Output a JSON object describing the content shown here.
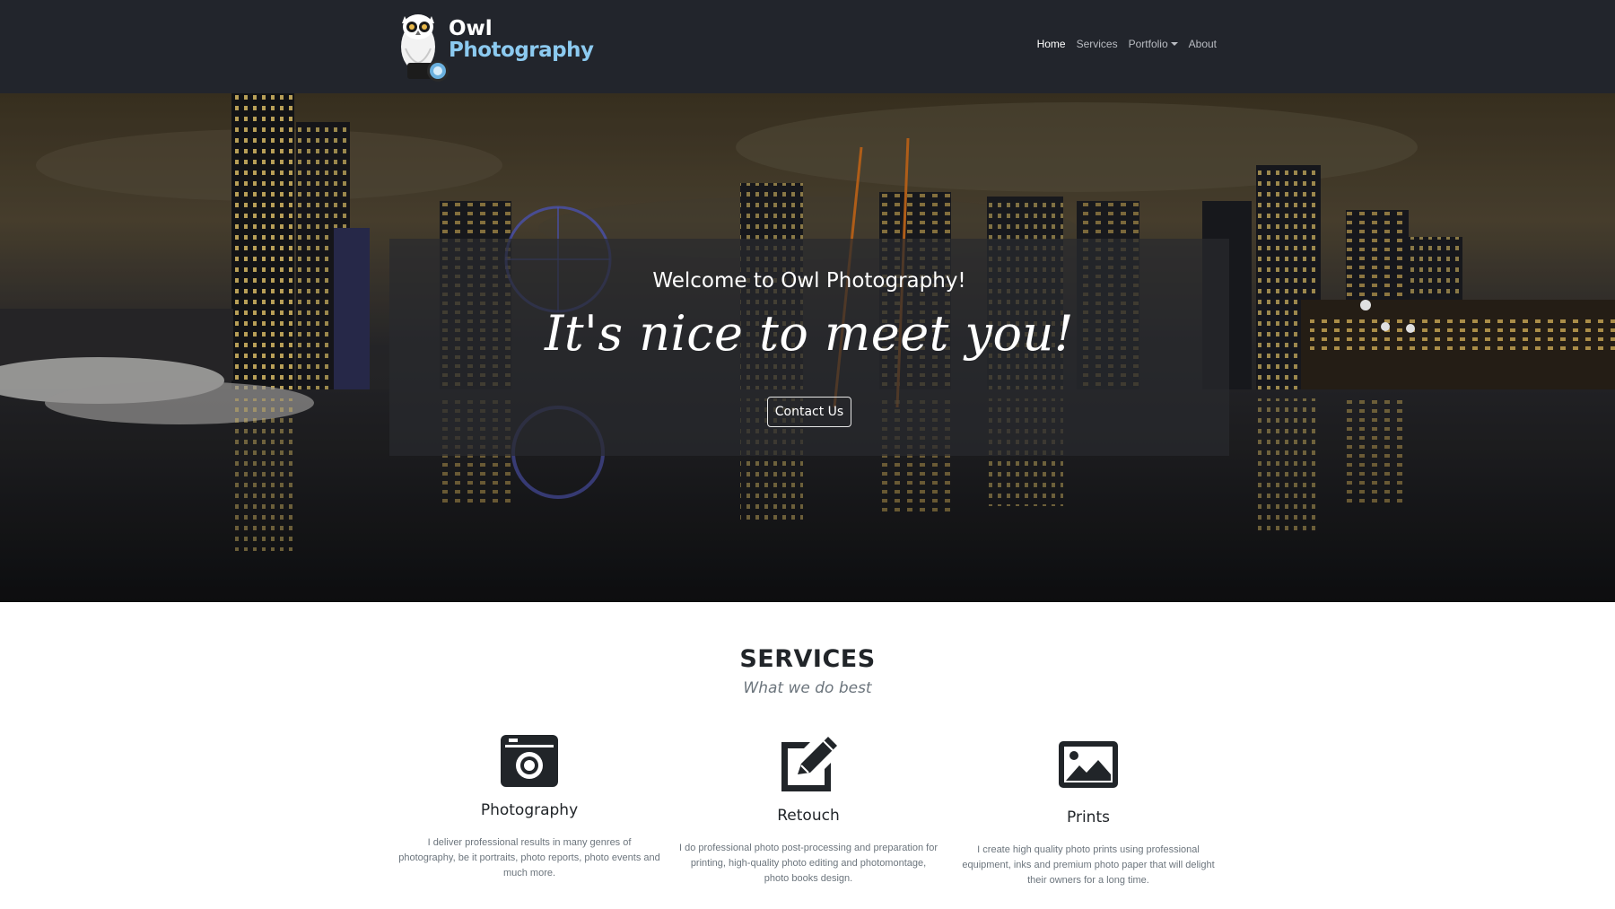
{
  "brand": {
    "line1": "Owl",
    "line2": "Photography"
  },
  "nav": {
    "items": [
      {
        "label": "Home",
        "active": true
      },
      {
        "label": "Services",
        "active": false
      },
      {
        "label": "Portfolio",
        "active": false,
        "dropdown": true
      },
      {
        "label": "About",
        "active": false
      }
    ]
  },
  "hero": {
    "welcome": "Welcome to Owl Photography!",
    "tagline": "It's nice to meet you!",
    "button_label": "Contact Us"
  },
  "services": {
    "title": "SERVICES",
    "subtitle": "What we do best",
    "items": [
      {
        "icon": "camera-icon",
        "name": "Photography",
        "description": "I deliver professional results in many genres of photography, be it portraits, photo reports, photo events and much more."
      },
      {
        "icon": "edit-icon",
        "name": "Retouch",
        "description": "I do professional photo post-processing and preparation for printing, high-quality photo editing and photomontage, photo books design."
      },
      {
        "icon": "image-icon",
        "name": "Prints",
        "description": "I create high quality photo prints using professional equipment, inks and premium photo paper that will delight their owners for a long time."
      }
    ]
  },
  "colors": {
    "navbar_bg": "#22252c",
    "brand_accent": "#8ccaf0",
    "icon_dark": "#212529",
    "muted_text": "#6c757d"
  }
}
